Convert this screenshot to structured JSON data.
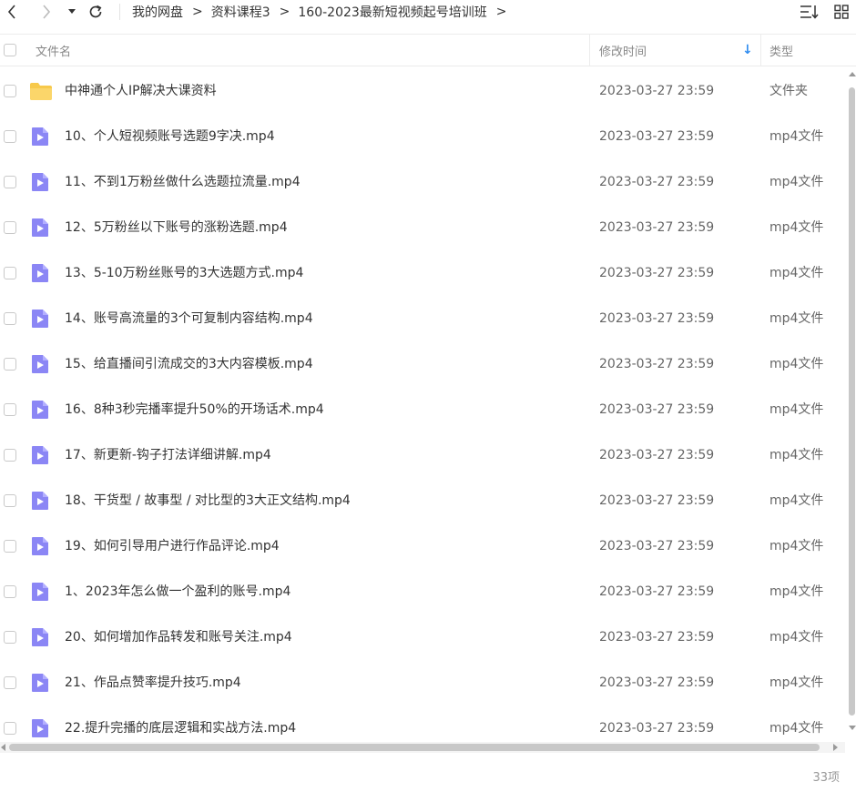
{
  "nav": {
    "breadcrumb": [
      "我的网盘",
      "资料课程3",
      "160-2023最新短视频起号培训班"
    ],
    "separator": ">"
  },
  "header": {
    "name": "文件名",
    "modified": "修改时间",
    "type": "类型",
    "sort_indicator": "↓"
  },
  "colors": {
    "accent": "#2f8cf0",
    "folder": "#f7c94b",
    "video": "#8b86f5"
  },
  "files": [
    {
      "icon": "folder-icon",
      "name": "中神通个人IP解决大课资料",
      "date": "2023-03-27 23:59",
      "type": "文件夹"
    },
    {
      "icon": "video-file-icon",
      "name": "10、个人短视频账号选题9字决.mp4",
      "date": "2023-03-27 23:59",
      "type": "mp4文件"
    },
    {
      "icon": "video-file-icon",
      "name": "11、不到1万粉丝做什么选题拉流量.mp4",
      "date": "2023-03-27 23:59",
      "type": "mp4文件"
    },
    {
      "icon": "video-file-icon",
      "name": "12、5万粉丝以下账号的涨粉选题.mp4",
      "date": "2023-03-27 23:59",
      "type": "mp4文件"
    },
    {
      "icon": "video-file-icon",
      "name": "13、5-10万粉丝账号的3大选题方式.mp4",
      "date": "2023-03-27 23:59",
      "type": "mp4文件"
    },
    {
      "icon": "video-file-icon",
      "name": "14、账号高流量的3个可复制内容结构.mp4",
      "date": "2023-03-27 23:59",
      "type": "mp4文件"
    },
    {
      "icon": "video-file-icon",
      "name": "15、给直播间引流成交的3大内容模板.mp4",
      "date": "2023-03-27 23:59",
      "type": "mp4文件"
    },
    {
      "icon": "video-file-icon",
      "name": "16、8种3秒完播率提升50%的开场话术.mp4",
      "date": "2023-03-27 23:59",
      "type": "mp4文件"
    },
    {
      "icon": "video-file-icon",
      "name": "17、新更新-钩子打法详细讲解.mp4",
      "date": "2023-03-27 23:59",
      "type": "mp4文件"
    },
    {
      "icon": "video-file-icon",
      "name": "18、干货型 / 故事型 / 对比型的3大正文结构.mp4",
      "date": "2023-03-27 23:59",
      "type": "mp4文件"
    },
    {
      "icon": "video-file-icon",
      "name": "19、如何引导用户进行作品评论.mp4",
      "date": "2023-03-27 23:59",
      "type": "mp4文件"
    },
    {
      "icon": "video-file-icon",
      "name": "1、2023年怎么做一个盈利的账号.mp4",
      "date": "2023-03-27 23:59",
      "type": "mp4文件"
    },
    {
      "icon": "video-file-icon",
      "name": "20、如何增加作品转发和账号关注.mp4",
      "date": "2023-03-27 23:59",
      "type": "mp4文件"
    },
    {
      "icon": "video-file-icon",
      "name": "21、作品点赞率提升技巧.mp4",
      "date": "2023-03-27 23:59",
      "type": "mp4文件"
    },
    {
      "icon": "video-file-icon",
      "name": "22.提升完播的底层逻辑和实战方法.mp4",
      "date": "2023-03-27 23:59",
      "type": "mp4文件"
    }
  ],
  "footer": {
    "count": "33项"
  }
}
